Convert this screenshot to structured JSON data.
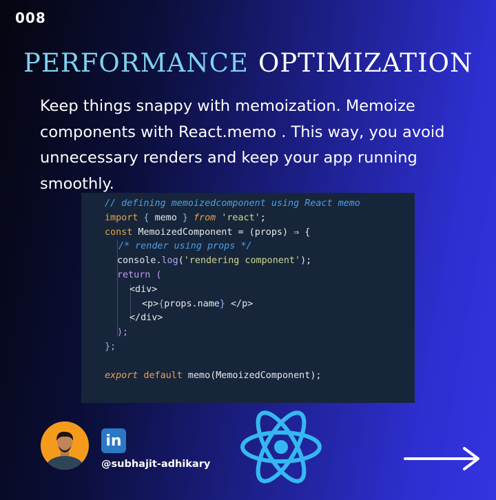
{
  "slide_number": "008",
  "title": {
    "accent": "PERFORMANCE",
    "plain": "OPTIMIZATION"
  },
  "intro": "Keep things snappy with memoization. Memoize components with React.memo . This way, you avoid unnecessary renders and keep your app running smoothly.",
  "code": {
    "line1": {
      "comment": "// defining memoizedcomponent using React memo"
    },
    "line2": {
      "kw": "import",
      "b1": " { ",
      "name": "memo",
      "b2": " } ",
      "from": "from",
      "str": " 'react'",
      "end": ";"
    },
    "line3": {
      "kw": "const",
      "name": " MemoizedComponent ",
      "eq": "= (",
      "param": "props",
      "arrow": ") ⇒ {"
    },
    "line4": {
      "comment": "/* render using props */"
    },
    "line5": {
      "obj": "console",
      "dot": ".",
      "fn": "log",
      "open": "(",
      "str": "'rendering component'",
      "close": ");"
    },
    "line6": {
      "kw": "return",
      "open": " ("
    },
    "line7": {
      "tag": "<div>"
    },
    "line8": {
      "open": "<p>",
      "b1": "{",
      "expr": "props.name",
      "b2": "}",
      "close": " </p>"
    },
    "line9": {
      "tag": "</div>"
    },
    "line10": {
      "close": ");"
    },
    "line11": {
      "close": "};"
    },
    "line12": {
      "text": ""
    },
    "line13": {
      "kw1": "export",
      "kw2": " default",
      "fn": " memo",
      "open": "(",
      "arg": "MemoizedComponent",
      "close": ");"
    }
  },
  "author": {
    "handle": "@subhajit-adhikary",
    "linkedin_label": "in"
  },
  "icons": {
    "linkedin": "linkedin-icon",
    "react": "react-logo-icon",
    "next": "arrow-right-icon"
  },
  "colors": {
    "title_accent": "#7fd3ef",
    "code_bg": "#17253a",
    "react_logo": "#35b8f0",
    "avatar_bg": "#f59b1c",
    "linkedin_bg": "#2b78c4"
  }
}
